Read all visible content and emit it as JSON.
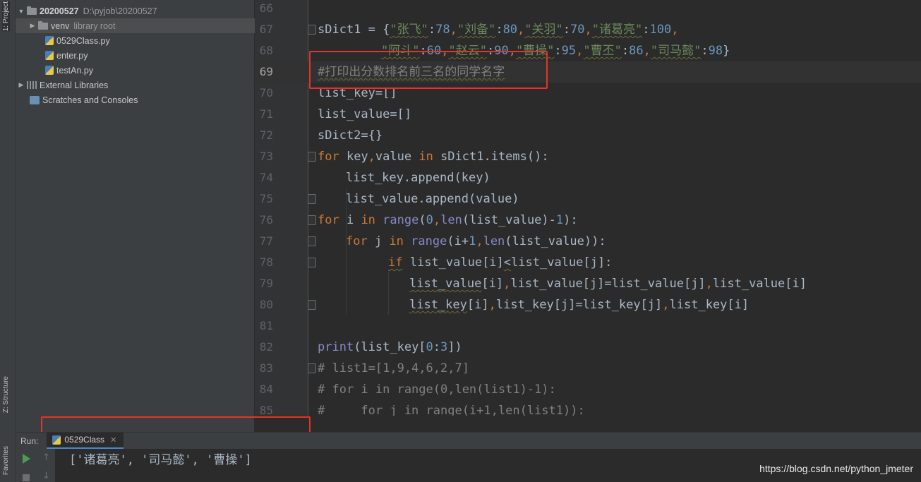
{
  "left_strip": {
    "project_tab": "1: Project",
    "structure_tab": "Z: Structure",
    "favorites_tab": "Favorites"
  },
  "project_tree": {
    "root_name": "20200527",
    "root_path": "D:\\pyjob\\20200527",
    "venv_name": "venv",
    "venv_hint": "library root",
    "files": [
      "0529Class.py",
      "enter.py",
      "testAn.py"
    ],
    "external_libraries": "External Libraries",
    "scratches": "Scratches and Consoles"
  },
  "editor": {
    "line_numbers": [
      "66",
      "67",
      "68",
      "69",
      "70",
      "71",
      "72",
      "73",
      "74",
      "75",
      "76",
      "77",
      "78",
      "79",
      "80",
      "81",
      "82",
      "83",
      "84",
      "85"
    ],
    "current_line": "69",
    "lines": {
      "l67": [
        "sDict1 = {",
        "\"张飞\"",
        ":",
        "78",
        ",",
        "\"刘备\"",
        ":",
        "80",
        ",",
        "\"关羽\"",
        ":",
        "70",
        ",",
        "\"诸葛亮\"",
        ":",
        "100",
        ","
      ],
      "l68": [
        "\"阿斗\"",
        ":",
        "60",
        ",",
        "\"赵云\"",
        ":",
        "90",
        ",",
        "\"曹操\"",
        ":",
        "95",
        ",",
        "\"曹丕\"",
        ":",
        "86",
        ",",
        "\"司马懿\"",
        ":",
        "98",
        "}"
      ],
      "l69": "#打印出分数排名前三名的同学名字",
      "l70": "list_key=[]",
      "l71": "list_value=[]",
      "l72": "sDict2={}",
      "l73": [
        "for",
        " key",
        ",",
        "value ",
        "in",
        " sDict1.items():"
      ],
      "l74": "list_key.append(key)",
      "l75": "list_value.append(value)",
      "l76": [
        "for",
        " i ",
        "in",
        " ",
        "range",
        "(",
        "0",
        ",",
        "len",
        "(list_value)-",
        "1",
        "):"
      ],
      "l77": [
        "for",
        " j ",
        "in",
        " ",
        "range",
        "(i+",
        "1",
        ",",
        "len",
        "(list_value)):"
      ],
      "l78": [
        "if",
        " list_value[i]",
        "<",
        "list_value[j]:"
      ],
      "l79": [
        "list_value",
        "[i]",
        ",",
        "list_value[j]=list_value[j]",
        ",",
        "list_value[i]"
      ],
      "l80": [
        "list_key",
        "[i]",
        ",",
        "list_key[j]=list_key[j]",
        ",",
        "list_key[i]"
      ],
      "l82": [
        "print",
        "(list_key[",
        "0",
        ":",
        "3",
        "])"
      ],
      "l83": "# list1=[1,9,4,6,2,7]",
      "l84": "# for i in range(0,len(list1)-1):",
      "l85": "#     for j in range(i+1,len(list1)):"
    }
  },
  "run_panel": {
    "label": "Run:",
    "tab_name": "0529Class",
    "output": "['诸葛亮', '司马懿', '曹操']"
  },
  "watermark": "https://blog.csdn.net/python_jmeter",
  "colors": {
    "highlight_box": "#e5332a",
    "keyword": "#cc7832",
    "number": "#6897bb",
    "string": "#6a8759",
    "comment": "#808080",
    "builtin": "#8888c6"
  }
}
